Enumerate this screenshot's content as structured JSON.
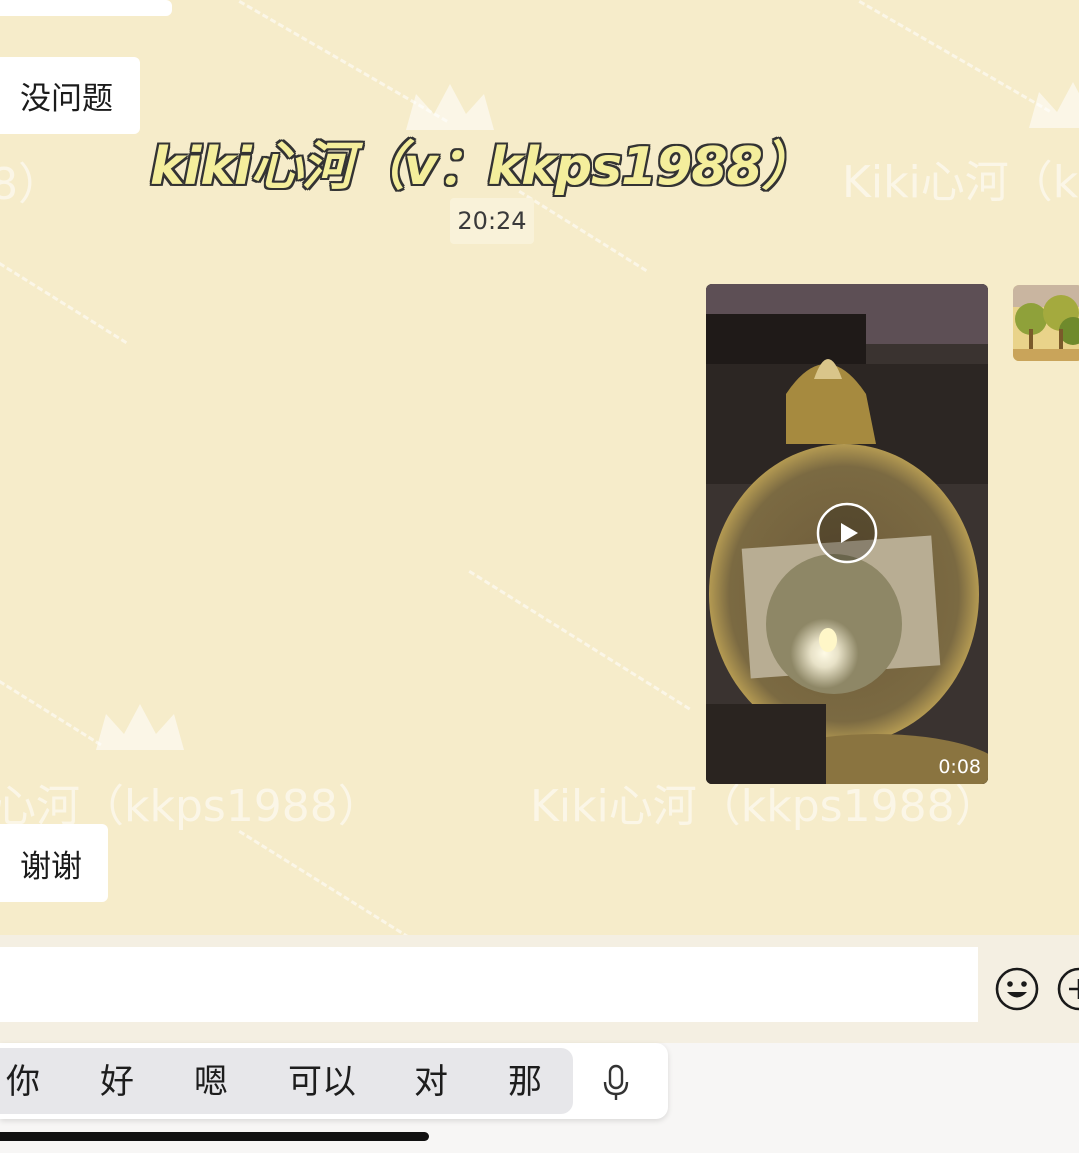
{
  "messages": {
    "first": "没问题",
    "watermark_caption": "kiki心河（v：kkps1988）",
    "time": "20:24",
    "video_duration": "0:08",
    "last": "谢谢"
  },
  "watermarks": {
    "left": "心河（kkps1988）",
    "center": "Kiki心河（kkps1988）",
    "right": "Kiki心河（k",
    "top_left": "8）"
  },
  "suggestions": [
    "你",
    "好",
    "嗯",
    "可以",
    "对",
    "那"
  ],
  "icons": [
    "play-icon",
    "emoji-icon",
    "plus-icon",
    "mic-icon",
    "crown-icon"
  ],
  "colors": {
    "chat_background": "#f6ecca",
    "bubble": "#ffffff",
    "caption_fill": "#f4ee9c"
  }
}
